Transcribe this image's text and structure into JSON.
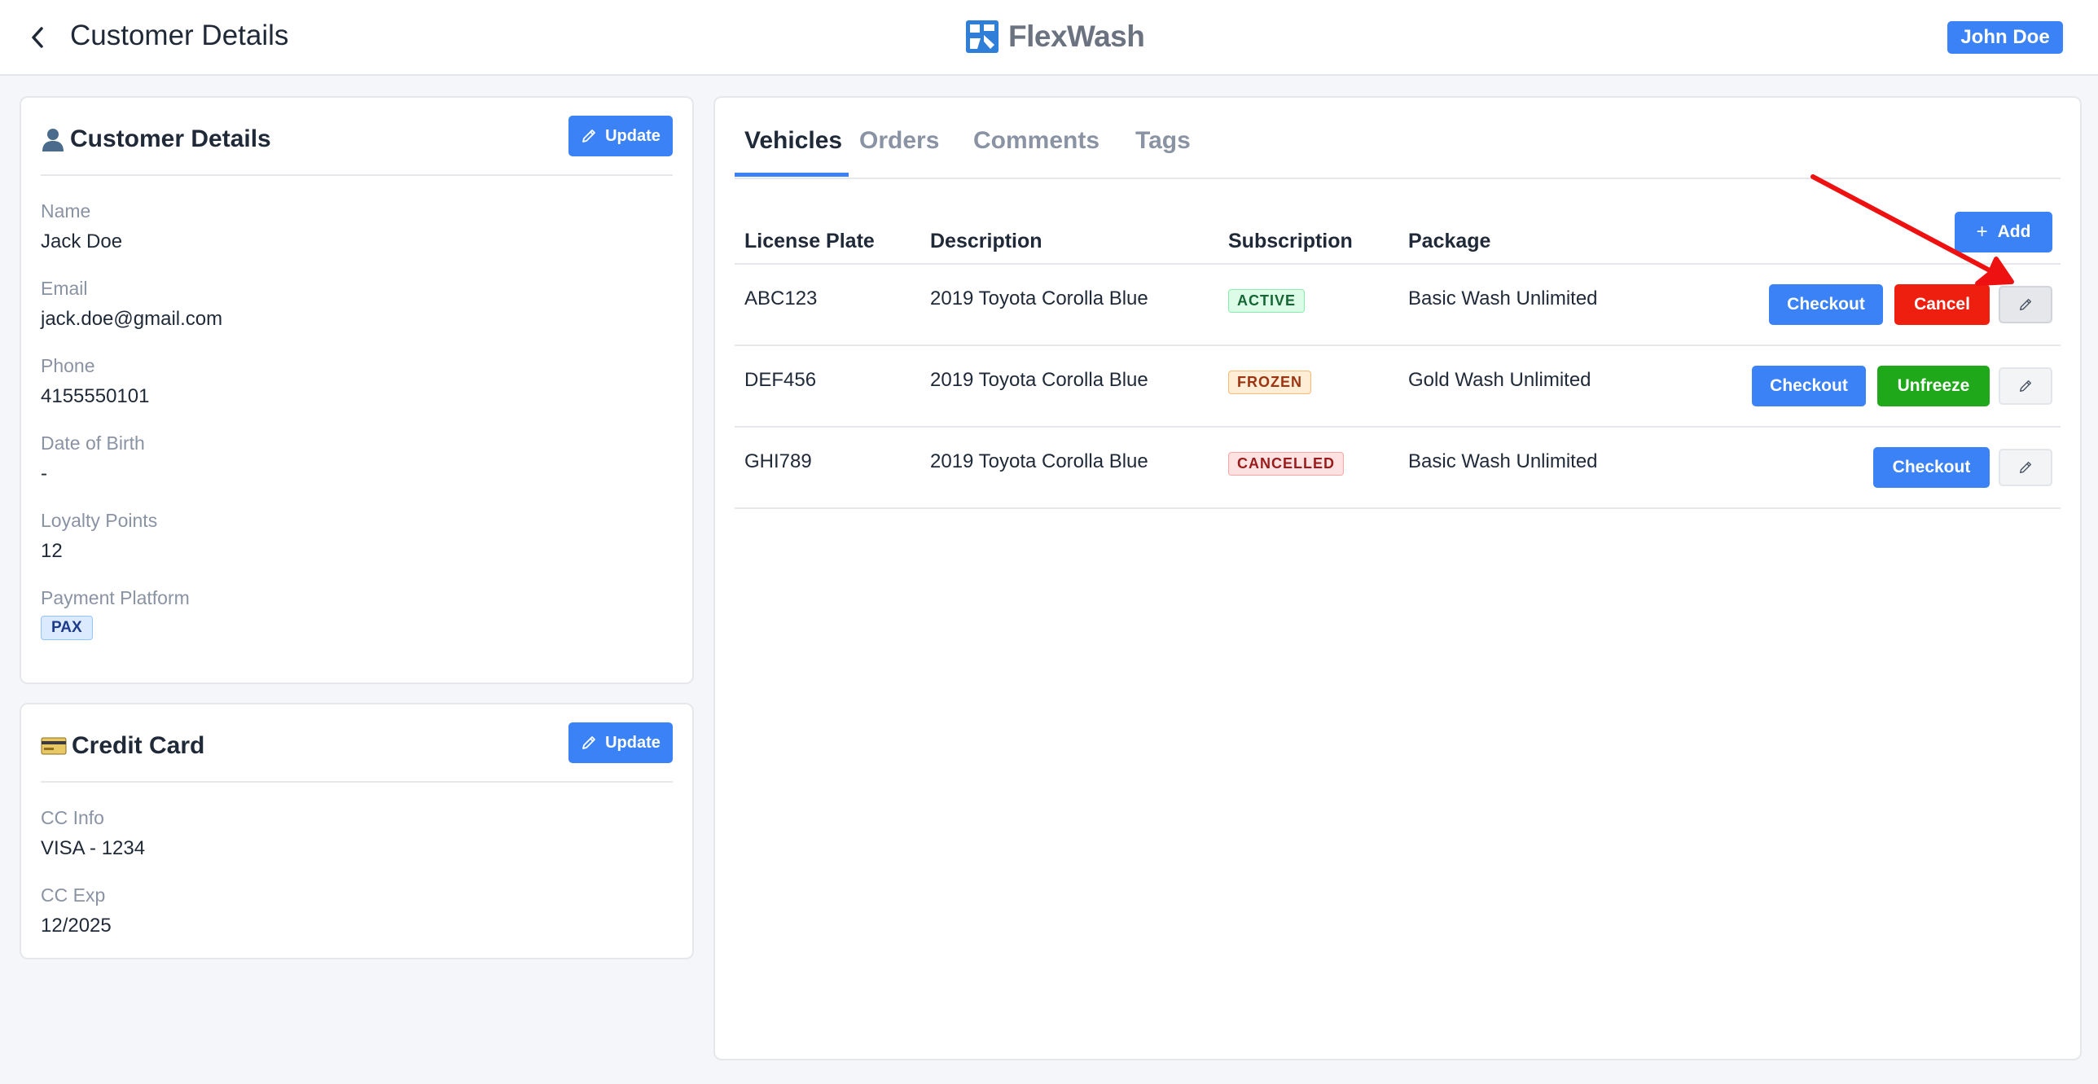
{
  "header": {
    "title": "Customer Details",
    "brand": "FlexWash",
    "user": "John Doe"
  },
  "customer": {
    "icon": "person-icon",
    "title": "Customer Details",
    "update_label": "Update",
    "fields": [
      {
        "label": "Name",
        "value": "Jack Doe"
      },
      {
        "label": "Email",
        "value": "jack.doe@gmail.com"
      },
      {
        "label": "Phone",
        "value": "4155550101"
      },
      {
        "label": "Date of Birth",
        "value": "-"
      },
      {
        "label": "Loyalty Points",
        "value": "12"
      },
      {
        "label": "Payment Platform",
        "value": "PAX"
      }
    ]
  },
  "credit_card": {
    "icon": "credit-card-icon",
    "title": "Credit Card",
    "update_label": "Update",
    "fields": [
      {
        "label": "CC Info",
        "value": "VISA - 1234"
      },
      {
        "label": "CC Exp",
        "value": "12/2025"
      }
    ]
  },
  "tabs": [
    {
      "label": "Vehicles",
      "active": true
    },
    {
      "label": "Orders",
      "active": false
    },
    {
      "label": "Comments",
      "active": false
    },
    {
      "label": "Tags",
      "active": false
    }
  ],
  "vehicles": {
    "add_label": "Add",
    "columns": [
      "License Plate",
      "Description",
      "Subscription",
      "Package"
    ],
    "rows": [
      {
        "plate": "ABC123",
        "description": "2019 Toyota Corolla Blue",
        "status": "ACTIVE",
        "package": "Basic Wash Unlimited",
        "checkout": "Checkout",
        "action": "Cancel"
      },
      {
        "plate": "DEF456",
        "description": "2019 Toyota Corolla Blue",
        "status": "FROZEN",
        "package": "Gold Wash Unlimited",
        "checkout": "Checkout",
        "action": "Unfreeze"
      },
      {
        "plate": "GHI789",
        "description": "2019 Toyota Corolla Blue",
        "status": "CANCELLED",
        "package": "Basic Wash Unlimited",
        "checkout": "Checkout",
        "action": ""
      }
    ]
  },
  "colors": {
    "accent": "#3b82f6",
    "danger": "#ef1f0f",
    "success": "#1fa81a",
    "annotation": "#ee1111"
  }
}
